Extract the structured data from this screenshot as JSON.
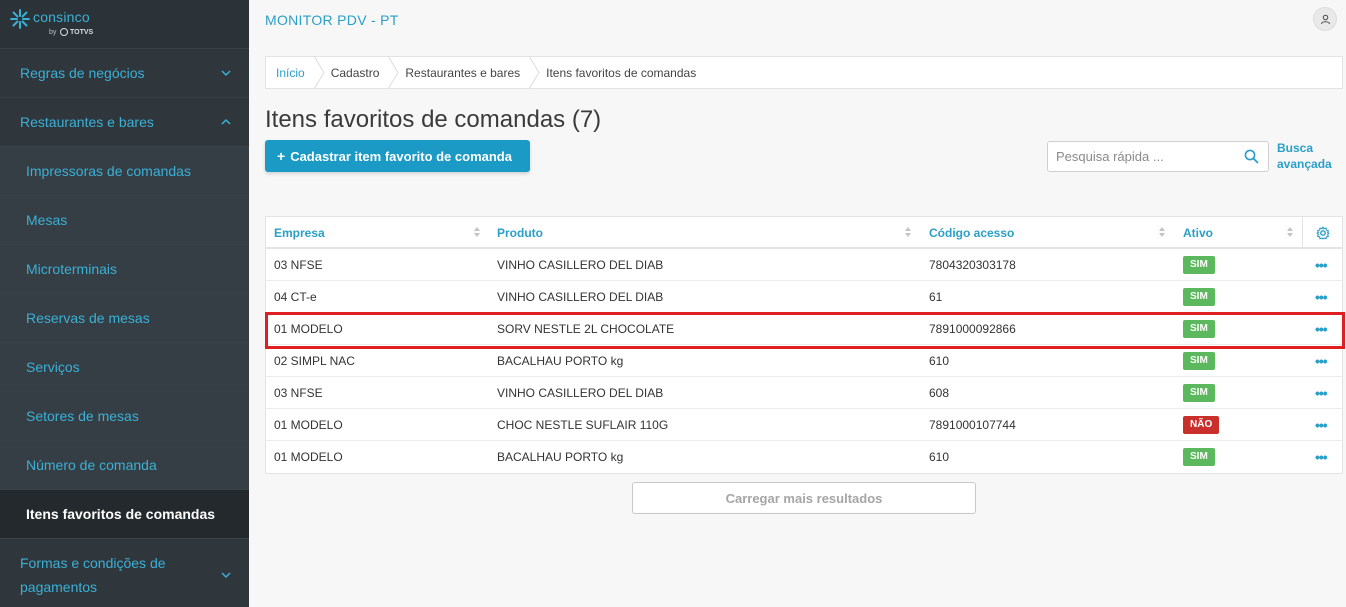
{
  "brand": {
    "name": "consinco",
    "by": "by",
    "totvs": "TOTVS"
  },
  "sidebar": {
    "items": [
      {
        "label": "Regras de negócios",
        "type": "group",
        "chevron": "down"
      },
      {
        "label": "Restaurantes e bares",
        "type": "group",
        "chevron": "up"
      },
      {
        "label": "Impressoras de comandas",
        "type": "sub"
      },
      {
        "label": "Mesas",
        "type": "sub"
      },
      {
        "label": "Microterminais",
        "type": "sub"
      },
      {
        "label": "Reservas de mesas",
        "type": "sub"
      },
      {
        "label": "Serviços",
        "type": "sub"
      },
      {
        "label": "Setores de mesas",
        "type": "sub"
      },
      {
        "label": "Número de comanda",
        "type": "sub"
      },
      {
        "label": "Itens favoritos de comandas",
        "type": "sub",
        "active": true
      },
      {
        "label": "Formas e condições de pagamentos",
        "type": "group",
        "chevron": "down"
      }
    ]
  },
  "header": {
    "app_title": "MONITOR PDV - PT"
  },
  "breadcrumb": [
    "Início",
    "Cadastro",
    "Restaurantes e bares",
    "Itens favoritos de comandas"
  ],
  "page": {
    "title": "Itens favoritos de comandas (7)",
    "add_button_label": "Cadastrar item favorito de comanda",
    "search_placeholder": "Pesquisa rápida ...",
    "advanced_search_line1": "Busca",
    "advanced_search_line2": "avançada",
    "load_more_label": "Carregar mais resultados"
  },
  "table": {
    "columns": [
      "Empresa",
      "Produto",
      "Código acesso",
      "Ativo"
    ],
    "rows": [
      {
        "empresa": "03 NFSE",
        "produto": "VINHO CASILLERO DEL DIAB",
        "codigo": "7804320303178",
        "ativo": "SIM"
      },
      {
        "empresa": "04 CT-e",
        "produto": "VINHO CASILLERO DEL DIAB",
        "codigo": "61",
        "ativo": "SIM"
      },
      {
        "empresa": "01 MODELO",
        "produto": "SORV NESTLE 2L CHOCOLATE",
        "codigo": "7891000092866",
        "ativo": "SIM"
      },
      {
        "empresa": "02 SIMPL NAC",
        "produto": "BACALHAU PORTO kg",
        "codigo": "610",
        "ativo": "SIM"
      },
      {
        "empresa": "03 NFSE",
        "produto": "VINHO CASILLERO DEL DIAB",
        "codigo": "608",
        "ativo": "SIM"
      },
      {
        "empresa": "01 MODELO",
        "produto": "CHOC NESTLE SUFLAIR 110G",
        "codigo": "7891000107744",
        "ativo": "NÃO"
      },
      {
        "empresa": "01 MODELO",
        "produto": "BACALHAU PORTO kg",
        "codigo": "610",
        "ativo": "SIM"
      }
    ],
    "highlighted_row": 2
  },
  "colors": {
    "accent": "#1a9ac4",
    "sidebar_bg": "#2c3338",
    "yes": "#5cb85c",
    "no": "#c9302c",
    "highlight": "#e02020"
  }
}
